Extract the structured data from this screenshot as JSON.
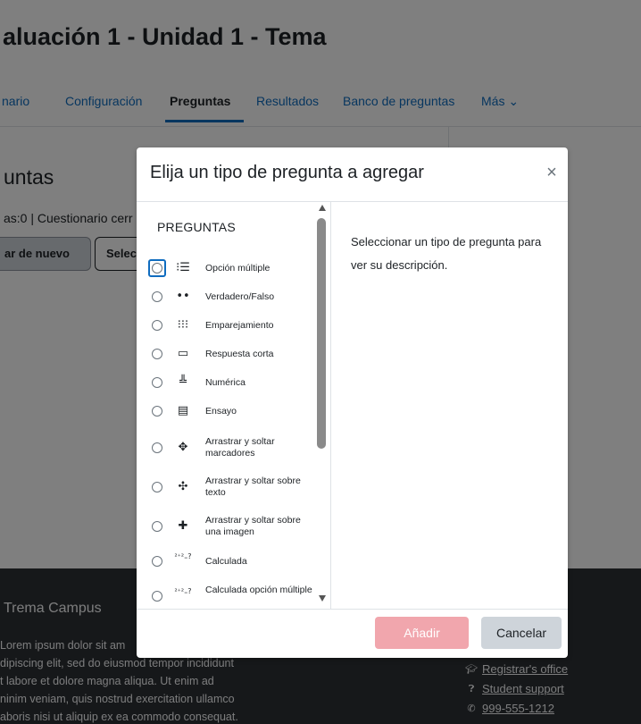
{
  "page": {
    "title": "aluación 1 - Unidad 1 - Tema",
    "tabs": [
      "nario",
      "Configuración",
      "Preguntas",
      "Resultados",
      "Banco de preguntas",
      "Más ⌄"
    ],
    "section_heading": "untas",
    "info_line": "as:0 | Cuestionario cerr",
    "button_again": "ar de nuevo",
    "button_select": "Selec"
  },
  "footer": {
    "brand": "Trema Campus",
    "paragraph": "Lorem ipsum dolor sit amet, adipiscing elit, sed do eiusmod tempor incididunt ut labore et dolore magna aliqua. Ut enim ad minim veniam, quis nostrud exercitation ullamco laboris nisi ut aliquip ex ea commodo consequat.",
    "paragraph_lines": [
      "Lorem ipsum dolor sit am",
      "dipiscing elit, sed do eiusmod tempor incididunt",
      "t labore et dolore magna aliqua. Ut enim ad",
      "ninim veniam, quis nostrud exercitation ullamco",
      "aboris nisi ut aliquip ex ea commodo consequat."
    ],
    "links": [
      {
        "icon": "graduation-cap-icon",
        "label": "Registrar's office"
      },
      {
        "icon": "question-circle-icon",
        "label": "Student support"
      },
      {
        "icon": "phone-icon",
        "label": "999-555-1212"
      }
    ]
  },
  "modal": {
    "title": "Elija un tipo de pregunta a agregar",
    "close_label": "×",
    "section_label": "PREGUNTAS",
    "description": "Seleccionar un tipo de pregunta para ver su descripción.",
    "add_button": "Añadir",
    "cancel_button": "Cancelar",
    "question_types": [
      {
        "label": "Opción múltiple",
        "icon": "multichoice-icon",
        "glyph": "⁝☰",
        "selected": true
      },
      {
        "label": "Verdadero/Falso",
        "icon": "truefalse-icon",
        "glyph": "••",
        "selected": false
      },
      {
        "label": "Emparejamiento",
        "icon": "match-icon",
        "glyph": "⁝⁝⁝",
        "selected": false
      },
      {
        "label": "Respuesta corta",
        "icon": "shortanswer-icon",
        "glyph": "▭",
        "selected": false
      },
      {
        "label": "Numérica",
        "icon": "numerical-icon",
        "glyph": "╩",
        "selected": false
      },
      {
        "label": "Ensayo",
        "icon": "essay-icon",
        "glyph": "▤",
        "selected": false
      },
      {
        "label": "Arrastrar y soltar marcadores",
        "icon": "ddmarker-icon",
        "glyph": "✥",
        "selected": false
      },
      {
        "label": "Arrastrar y soltar sobre texto",
        "icon": "ddwtos-icon",
        "glyph": "✣",
        "selected": false
      },
      {
        "label": "Arrastrar y soltar sobre una imagen",
        "icon": "ddimageortext-icon",
        "glyph": "✚",
        "selected": false
      },
      {
        "label": "Calculada",
        "icon": "calculated-icon",
        "glyph": "²⁺²₌?",
        "selected": false
      },
      {
        "label": "Calculada opción múltiple",
        "icon": "calculatedmulti-icon",
        "glyph": "²⁺²₌?",
        "selected": false
      }
    ]
  },
  "colors": {
    "accent": "#0f6cbf",
    "add_button_bg": "#f1a6ad",
    "footer_bg": "#2c3034"
  }
}
